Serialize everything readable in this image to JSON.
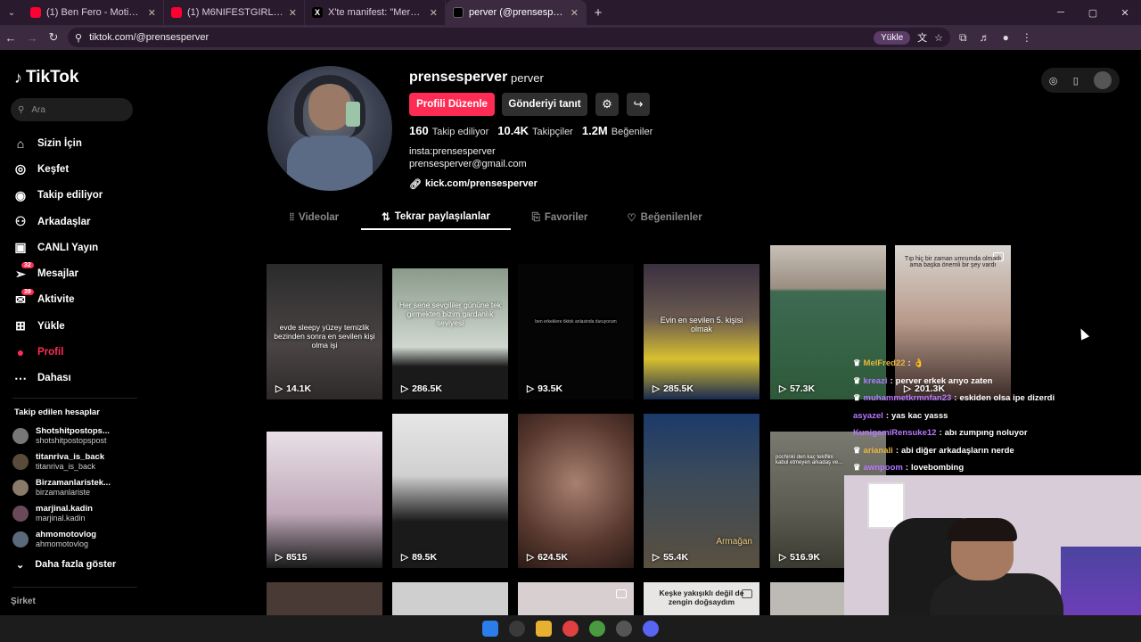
{
  "browser": {
    "tabs": [
      {
        "title": "(1) Ben Fero - Motivasyon [Offi",
        "icon": "youtube-icon"
      },
      {
        "title": "(1) M6NIFESTGIRLS | 3. Bölüm -",
        "icon": "youtube-icon"
      },
      {
        "title": "X'te manifest: \"Merhaba, biiiiz",
        "icon": "x-icon"
      },
      {
        "title": "perver (@prensesperver) | TikTo",
        "icon": "tiktok-icon"
      }
    ],
    "url": "tiktok.com/@prensesperver",
    "upload_pill": "Yükle"
  },
  "sidebar": {
    "logo": "TikTok",
    "search_placeholder": "Ara",
    "nav": [
      {
        "label": "Sizin İçin",
        "icon": "home-icon"
      },
      {
        "label": "Keşfet",
        "icon": "compass-icon"
      },
      {
        "label": "Takip ediliyor",
        "icon": "following-avatar-icon"
      },
      {
        "label": "Arkadaşlar",
        "icon": "friends-icon"
      },
      {
        "label": "CANLI Yayın",
        "icon": "live-icon"
      },
      {
        "label": "Mesajlar",
        "icon": "send-icon",
        "badge": "32"
      },
      {
        "label": "Aktivite",
        "icon": "inbox-icon",
        "badge": "39"
      },
      {
        "label": "Yükle",
        "icon": "plus-square-icon"
      },
      {
        "label": "Profil",
        "icon": "profile-avatar-icon"
      },
      {
        "label": "Dahası",
        "icon": "dots-icon"
      }
    ],
    "following_header": "Takip edilen hesaplar",
    "following": [
      {
        "name": "Shotshitpostops...",
        "handle": "shotshitpostopspost"
      },
      {
        "name": "titanriva_is_back",
        "handle": "titanriva_is_back"
      },
      {
        "name": "Birzamanlaristek...",
        "handle": "birzamanlariste"
      },
      {
        "name": "marjinal.kadin",
        "handle": "marjinal.kadin"
      },
      {
        "name": "ahmomotovlog",
        "handle": "ahmomotovlog"
      }
    ],
    "show_more": "Daha fazla göster",
    "company": "Şirket"
  },
  "profile": {
    "username": "prensesperver",
    "display_name": "perver",
    "edit_button": "Profili Düzenle",
    "promote_button": "Gönderiyi tanıt",
    "following_count": "160",
    "following_label": "Takip ediliyor",
    "followers_count": "10.4K",
    "followers_label": "Takipçiler",
    "likes_count": "1.2M",
    "likes_label": "Beğeniler",
    "bio_line1": "insta:prensesperver",
    "bio_line2": "prensesperver@gmail.com",
    "link": "kick.com/prensesperver"
  },
  "tabs": [
    {
      "label": "Videolar",
      "icon": "grid-icon",
      "active": false
    },
    {
      "label": "Tekrar paylaşılanlar",
      "icon": "repost-icon",
      "active": true
    },
    {
      "label": "Favoriler",
      "icon": "bookmark-icon",
      "active": false
    },
    {
      "label": "Beğenilenler",
      "icon": "heart-icon",
      "active": false
    }
  ],
  "videos_row1": [
    {
      "views": "14.1K",
      "caption": "evde sleepy yüzey temizlik bezinden sonra en sevilen kişi olma işi"
    },
    {
      "views": "286.5K",
      "caption": "Her sene sevgililer gününe tek girmekten bizim gardanlık seviyesi"
    },
    {
      "views": "93.5K",
      "caption": "ben erkeklere tiktok anlasinda duruyorum"
    },
    {
      "views": "285.5K",
      "caption": "Evin en sevilen 5. kişisi olmak"
    },
    {
      "views": "57.3K",
      "caption": ""
    },
    {
      "views": "201.3K",
      "caption": "Tıp hiç bir zaman umrumda olmadı ama başka önemli bir şey vardı"
    }
  ],
  "videos_row2": [
    {
      "views": "8515",
      "caption": ""
    },
    {
      "views": "89.5K",
      "caption": ""
    },
    {
      "views": "624.5K",
      "caption": ""
    },
    {
      "views": "55.4K",
      "caption": "Armağan"
    },
    {
      "views": "516.9K",
      "caption": "pochinki den kaç tekiflini kabul etmeyen arkadaş ve..."
    }
  ],
  "videos_row3": [
    {
      "caption": ""
    },
    {
      "caption": ""
    },
    {
      "caption": ""
    },
    {
      "caption": "Keşke yakışıklı değil de zengin doğsaydım"
    },
    {
      "caption": ""
    }
  ],
  "chat": [
    {
      "user": "MelFred22",
      "msg": "👌",
      "color": "#e8b73c"
    },
    {
      "user": "kreazi",
      "msg": "perver erkek arıyo zaten",
      "color": "#b678ff"
    },
    {
      "user": "muhammetkrmnfan23",
      "msg": "eskiden olsa ipe dizerdi",
      "color": "#b678ff"
    },
    {
      "user": "asyazel",
      "msg": "yas kac yasss",
      "color": "#b678ff"
    },
    {
      "user": "KunigamiRensuke12",
      "msg": "abı zumpıng noluyor",
      "color": "#b678ff"
    },
    {
      "user": "arianali",
      "msg": "abi diğer arkadaşların nerde",
      "color": "#e8b73c"
    },
    {
      "user": "awnpoom",
      "msg": "lovebombing",
      "color": "#b678ff"
    }
  ],
  "colors": {
    "accent": "#fe2c55",
    "chrome": "#3b2a40"
  }
}
